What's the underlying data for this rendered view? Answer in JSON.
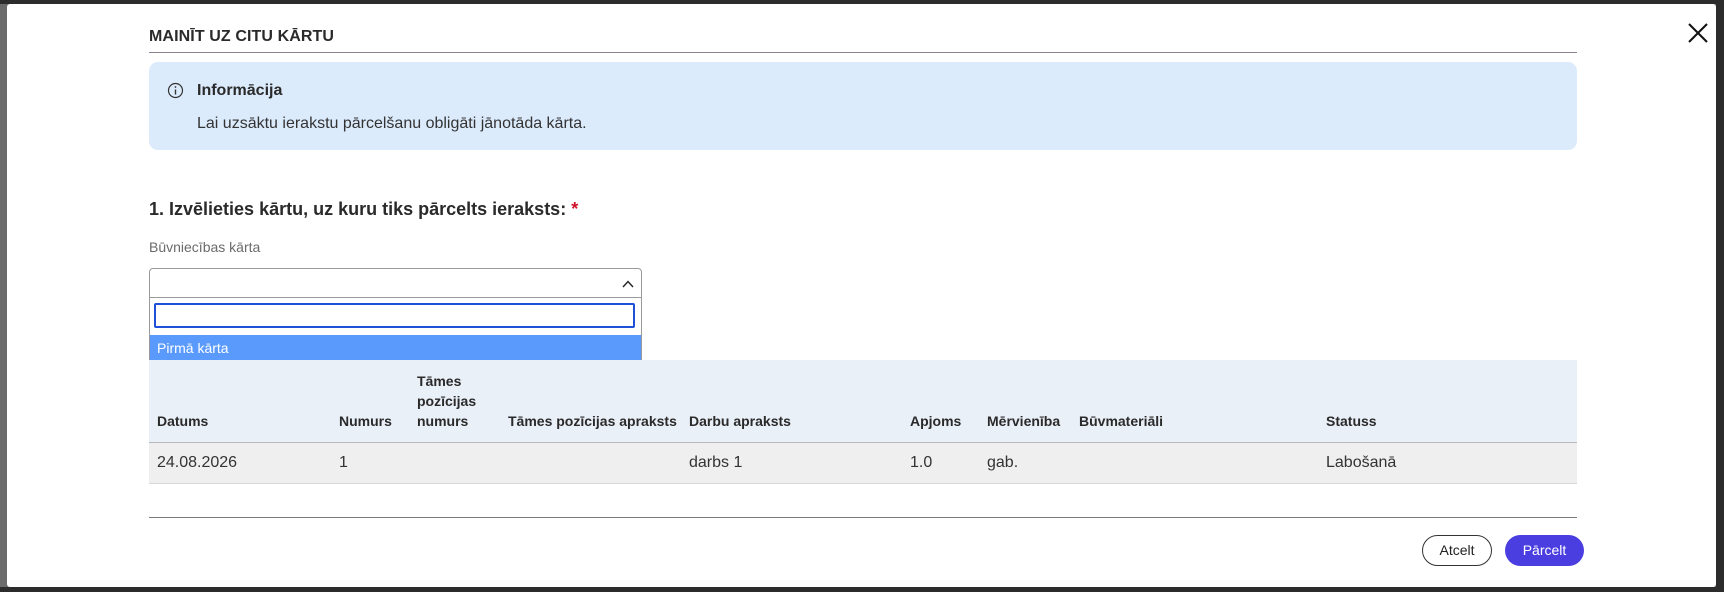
{
  "dialog": {
    "title": "MAINĪT UZ CITU KĀRTU",
    "close_icon": "close-icon"
  },
  "info": {
    "icon": "info-icon",
    "heading": "Informācija",
    "text": "Lai uzsāktu ierakstu pārcelšanu obligāti jānotāda kārta."
  },
  "step": {
    "heading": "1. Izvēlieties kārtu, uz kuru tiks pārcelts ieraksts:",
    "required_mark": "*"
  },
  "field": {
    "label": "Būvniecības kārta",
    "value": "",
    "chevron_icon": "chevron-up-icon",
    "search_value": "",
    "options": [
      "Pirmā kārta"
    ],
    "highlighted_option": "Pirmā kārta"
  },
  "table": {
    "headers": [
      "Datums",
      "Numurs",
      "Tāmes pozīcijas numurs",
      "Tāmes pozīcijas apraksts",
      "Darbu apraksts",
      "Apjoms",
      "Mērvienība",
      "Būvmateriāli",
      "Statuss"
    ],
    "rows": [
      [
        "24.08.2026",
        "1",
        "",
        "",
        "darbs 1",
        "1.0",
        "gab.",
        "",
        "Labošanā"
      ]
    ]
  },
  "footer": {
    "cancel_label": "Atcelt",
    "submit_label": "Pārcelt"
  },
  "colors": {
    "accent": "#4a3ee0",
    "info_bg": "#dcebfc",
    "option_highlight": "#5a9afc",
    "focus_border": "#1e50d8",
    "required": "#d0102b"
  }
}
